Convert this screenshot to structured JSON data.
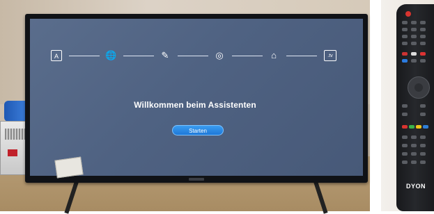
{
  "tv_screen": {
    "background_color": "#4f6282",
    "setup_steps": [
      {
        "icon": "language-icon"
      },
      {
        "icon": "globe-region-icon"
      },
      {
        "icon": "terms-edit-icon"
      },
      {
        "icon": "network-icon"
      },
      {
        "icon": "home-mode-icon"
      },
      {
        "icon": "tv-channel-icon",
        "label": ".tv"
      }
    ],
    "welcome_text": "Willkommen beim Assistenten",
    "start_button_label": "Starten",
    "accent_color": "#1e78d8"
  },
  "remote": {
    "brand_logo": "DYON",
    "color_keys": [
      "#d8342f",
      "#3bb44a",
      "#f0c419",
      "#2f7fd8"
    ]
  }
}
